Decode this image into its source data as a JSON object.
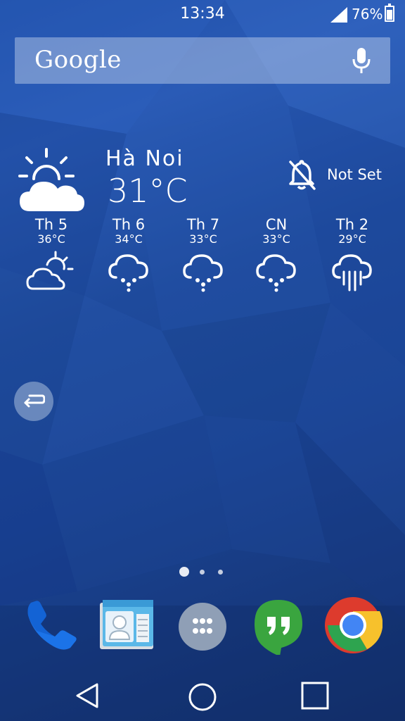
{
  "status_bar": {
    "time": "13:34",
    "battery_percent": "76%",
    "battery_level": 0.76
  },
  "search": {
    "logo_text": "Google",
    "icon": "mic-icon"
  },
  "weather": {
    "city": "Hà  Noi",
    "temperature": "31°C",
    "current_icon": "sun-behind-cloud-icon",
    "alarm": {
      "icon": "bell-off-icon",
      "label": "Not Set"
    },
    "forecast": [
      {
        "day": "Th 5",
        "temp": "36°C",
        "icon": "partly-cloudy-icon"
      },
      {
        "day": "Th 6",
        "temp": "34°C",
        "icon": "rain-cloud-icon"
      },
      {
        "day": "Th 7",
        "temp": "33°C",
        "icon": "rain-cloud-icon"
      },
      {
        "day": "CN",
        "temp": "33°C",
        "icon": "rain-cloud-icon"
      },
      {
        "day": "Th 2",
        "temp": "29°C",
        "icon": "heavy-rain-icon"
      }
    ]
  },
  "home_pages": {
    "count": 3,
    "current": 1
  },
  "dock": [
    {
      "app": "Phone",
      "icon": "phone-icon"
    },
    {
      "app": "Contacts",
      "icon": "contacts-icon"
    },
    {
      "app": "App drawer",
      "icon": "app-drawer-icon"
    },
    {
      "app": "Hangouts",
      "icon": "hangouts-icon"
    },
    {
      "app": "Chrome",
      "icon": "chrome-icon"
    }
  ],
  "nav_bar": [
    "back-icon",
    "home-icon",
    "recents-icon"
  ],
  "colors": {
    "hangouts_green": "#3aa53f",
    "phone_blue": "#1b73e8",
    "contacts_blue": "#5bb8e8"
  }
}
